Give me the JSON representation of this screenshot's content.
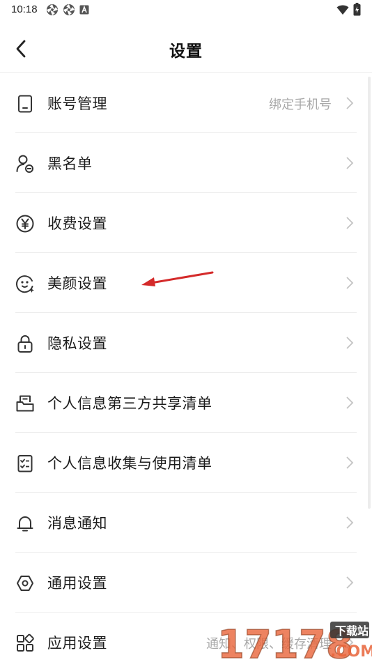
{
  "status_bar": {
    "time": "10:18",
    "left_icons": [
      "camera-shutter-icon",
      "camera-shutter-icon",
      "notification-a-icon"
    ],
    "right_icons": [
      "wifi-icon",
      "battery-charging-icon"
    ]
  },
  "header": {
    "title": "设置",
    "back_icon": "chevron-left-icon"
  },
  "settings": [
    {
      "label": "账号管理",
      "value": "绑定手机号",
      "icon": "phone-icon"
    },
    {
      "label": "黑名单",
      "value": "",
      "icon": "user-block-icon"
    },
    {
      "label": "收费设置",
      "value": "",
      "icon": "yen-icon"
    },
    {
      "label": "美颜设置",
      "value": "",
      "icon": "face-beauty-icon"
    },
    {
      "label": "隐私设置",
      "value": "",
      "icon": "lock-icon"
    },
    {
      "label": "个人信息第三方共享清单",
      "value": "",
      "icon": "share-list-icon"
    },
    {
      "label": "个人信息收集与使用清单",
      "value": "",
      "icon": "checklist-icon"
    },
    {
      "label": "消息通知",
      "value": "",
      "icon": "bell-icon"
    },
    {
      "label": "通用设置",
      "value": "",
      "icon": "settings-hexagon-icon"
    },
    {
      "label": "应用设置",
      "value": "通知、权限、缓存清理",
      "icon": "apps-grid-icon"
    }
  ],
  "watermark": {
    "text": "17178",
    "sub": "下载站",
    "domain": ".COM"
  },
  "colors": {
    "annotation_arrow": "#d42a2a",
    "watermark_fill": "#e05a2a",
    "divider": "#ededed",
    "secondary_text": "#a8a8a8"
  }
}
